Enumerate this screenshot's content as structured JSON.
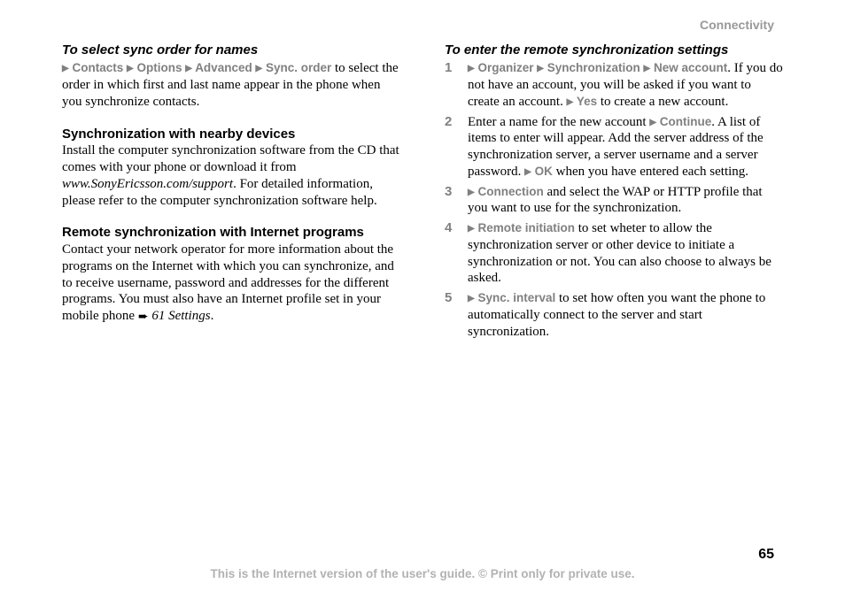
{
  "header": {
    "section": "Connectivity"
  },
  "left": {
    "h1": "To select sync order for names",
    "nav1": {
      "a": "Contacts",
      "b": "Options",
      "c": "Advanced",
      "d": "Sync. order"
    },
    "p1": "to select the order in which first and last name appear in the phone when you synchronize contacts.",
    "h2": "Synchronization with nearby devices",
    "p2a": "Install the computer synchronization software from the CD that comes with your phone or download it from ",
    "p2link": "www.SonyEricsson.com/support",
    "p2b": ". For detailed information, please refer to the computer synchronization software help.",
    "h3": "Remote synchronization with Internet programs",
    "p3a": "Contact your network operator for more information about the programs on the Internet with which you can synchronize, and to receive username, password and addresses for the different programs. You must also have an Internet profile set in your mobile phone ",
    "p3xref": "61 Settings",
    "p3b": "."
  },
  "right": {
    "h1": "To enter the remote synchronization settings",
    "steps": [
      {
        "n": "1",
        "nav1": {
          "a": "Organizer",
          "b": "Synchronization",
          "c": "New account"
        },
        "t1": ". If you do not have an account, you will be asked if you want to create an account. ",
        "nav2": "Yes",
        "t2": " to create a new account."
      },
      {
        "n": "2",
        "t0": "Enter a name for the new account ",
        "nav1": "Continue",
        "t1": ". A list of items to enter will appear. Add the server address of the synchronization server, a server username and a server password. ",
        "nav2": "OK",
        "t2": " when you have entered each setting."
      },
      {
        "n": "3",
        "nav1": "Connection",
        "t1": " and select the WAP or HTTP profile that you want to use for the synchronization."
      },
      {
        "n": "4",
        "nav1": "Remote initiation",
        "t1": " to set wheter to allow the synchronization server or other device to initiate a synchronization or not. You can also choose to always be asked."
      },
      {
        "n": "5",
        "nav1": "Sync. interval",
        "t1": " to set how often you want the phone to automatically connect to the server and start syncronization."
      }
    ]
  },
  "footer": {
    "page": "65",
    "text": "This is the Internet version of the user's guide. © Print only for private use."
  }
}
